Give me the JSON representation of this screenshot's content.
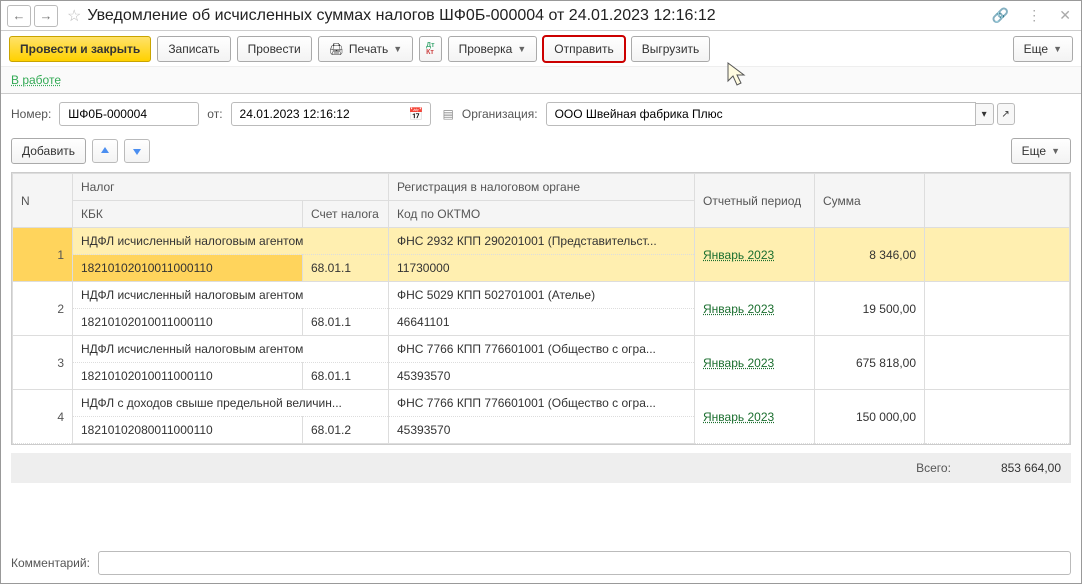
{
  "title": "Уведомление об исчисленных суммах налогов ШФ0Б-000004 от 24.01.2023 12:16:12",
  "toolbar": {
    "submit_close": "Провести и закрыть",
    "save": "Записать",
    "post": "Провести",
    "print": "Печать",
    "check": "Проверка",
    "send": "Отправить",
    "export": "Выгрузить",
    "more": "Еще"
  },
  "status": {
    "label": "В работе"
  },
  "fields": {
    "number_label": "Номер:",
    "number": "ШФ0Б-000004",
    "from_label": "от:",
    "date": "24.01.2023 12:16:12",
    "org_label": "Организация:",
    "org": "ООО Швейная фабрика Плюс"
  },
  "tableToolbar": {
    "add": "Добавить",
    "more": "Еще"
  },
  "headers": {
    "n": "N",
    "tax": "Налог",
    "kbk": "КБК",
    "acct": "Счет налога",
    "reg": "Регистрация в налоговом органе",
    "oktmo": "Код по ОКТМО",
    "period": "Отчетный период",
    "sum": "Сумма"
  },
  "rows": [
    {
      "n": "1",
      "tax": "НДФЛ исчисленный налоговым агентом",
      "kbk": "18210102010011000110",
      "acct": "68.01.1",
      "reg": "ФНС 2932 КПП 290201001 (Представительст...",
      "oktmo": "11730000",
      "period": "Январь 2023",
      "sum": "8 346,00"
    },
    {
      "n": "2",
      "tax": "НДФЛ исчисленный налоговым агентом",
      "kbk": "18210102010011000110",
      "acct": "68.01.1",
      "reg": "ФНС 5029 КПП 502701001 (Ателье)",
      "oktmo": "46641101",
      "period": "Январь 2023",
      "sum": "19 500,00"
    },
    {
      "n": "3",
      "tax": "НДФЛ исчисленный налоговым агентом",
      "kbk": "18210102010011000110",
      "acct": "68.01.1",
      "reg": "ФНС 7766 КПП 776601001 (Общество с огра...",
      "oktmo": "45393570",
      "period": "Январь 2023",
      "sum": "675 818,00"
    },
    {
      "n": "4",
      "tax": "НДФЛ с доходов свыше предельной величин...",
      "kbk": "18210102080011000110",
      "acct": "68.01.2",
      "reg": "ФНС 7766 КПП 776601001 (Общество с огра...",
      "oktmo": "45393570",
      "period": "Январь 2023",
      "sum": "150 000,00"
    }
  ],
  "total": {
    "label": "Всего:",
    "value": "853 664,00"
  },
  "comment": {
    "label": "Комментарий:",
    "value": ""
  }
}
